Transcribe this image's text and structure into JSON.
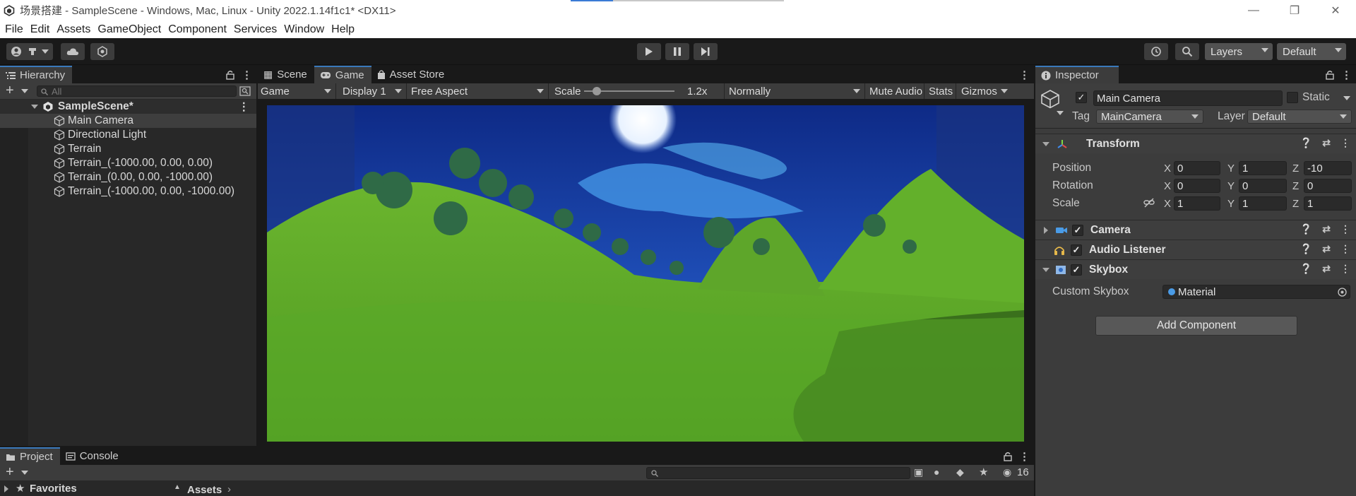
{
  "window": {
    "title": "场景搭建 - SampleScene - Windows, Mac, Linux - Unity 2022.1.14f1c1* <DX11>"
  },
  "menu": [
    "File",
    "Edit",
    "Assets",
    "GameObject",
    "Component",
    "Services",
    "Window",
    "Help"
  ],
  "toolbar": {
    "layers_label": "Layers",
    "layout_label": "Default"
  },
  "hierarchy": {
    "tab_label": "Hierarchy",
    "search_placeholder": "All",
    "scene_name": "SampleScene*",
    "items": [
      "Main Camera",
      "Directional Light",
      "Terrain",
      "Terrain_(-1000.00, 0.00, 0.00)",
      "Terrain_(0.00, 0.00, -1000.00)",
      "Terrain_(-1000.00, 0.00, -1000.00)"
    ],
    "selected_index": 0
  },
  "game_view": {
    "tabs": [
      "Scene",
      "Game",
      "Asset Store"
    ],
    "active_tab": "Game",
    "view_mode": "Game",
    "display": "Display 1",
    "aspect": "Free Aspect",
    "scale_label": "Scale",
    "scale_value": "1.2x",
    "play_mode": "Normally",
    "mute_audio": "Mute Audio",
    "stats": "Stats",
    "gizmos": "Gizmos"
  },
  "inspector": {
    "tab_label": "Inspector",
    "object_name": "Main Camera",
    "static_label": "Static",
    "tag_label": "Tag",
    "tag_value": "MainCamera",
    "layer_label": "Layer",
    "layer_value": "Default",
    "transform": {
      "title": "Transform",
      "position_label": "Position",
      "position": {
        "x": "0",
        "y": "1",
        "z": "-10"
      },
      "rotation_label": "Rotation",
      "rotation": {
        "x": "0",
        "y": "0",
        "z": "0"
      },
      "scale_label": "Scale",
      "scale": {
        "x": "1",
        "y": "1",
        "z": "1"
      },
      "axis_x": "X",
      "axis_y": "Y",
      "axis_z": "Z"
    },
    "components": [
      "Camera",
      "Audio Listener",
      "Skybox"
    ],
    "skybox": {
      "field_label": "Custom Skybox",
      "field_value": "Material"
    },
    "add_component": "Add Component"
  },
  "bottom": {
    "tabs": [
      "Project",
      "Console"
    ],
    "favorites": "Favorites",
    "assets_breadcrumb": "Assets",
    "hidden_count": "16"
  },
  "colors": {
    "accent": "#3a79bb",
    "sky": "#1a3f9a",
    "grass": "#5da62c"
  }
}
